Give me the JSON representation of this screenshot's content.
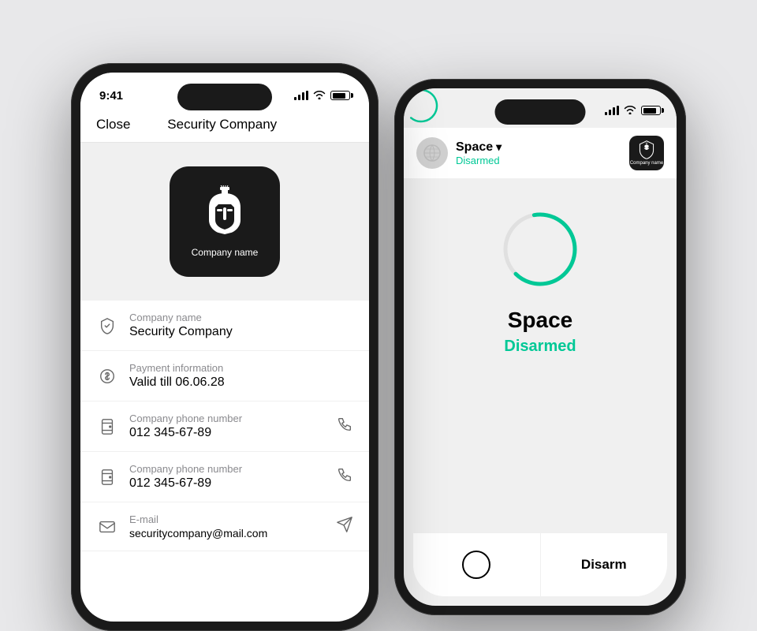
{
  "scene": {
    "bg_color": "#e8e8ea"
  },
  "phone1": {
    "status_bar": {
      "time": "9:41"
    },
    "nav": {
      "close_label": "Close",
      "title": "Security Company"
    },
    "logo": {
      "company_name": "Company name"
    },
    "rows": [
      {
        "label": "Company name",
        "value": "Security Company",
        "icon": "shield",
        "has_action": false
      },
      {
        "label": "Payment information",
        "value": "Valid till 06.06.28",
        "icon": "dollar",
        "has_action": false
      },
      {
        "label": "Company phone number",
        "value": "012 345-67-89",
        "icon": "phone-outline",
        "has_action": true
      },
      {
        "label": "Company phone number",
        "value": "012 345-67-89",
        "icon": "phone-outline",
        "has_action": true
      },
      {
        "label": "E-mail",
        "value": "securitycompany@mail.com",
        "icon": "mail",
        "has_action": true
      }
    ]
  },
  "phone2": {
    "header": {
      "space_name": "Space",
      "chevron": "▾",
      "status": "Disarmed",
      "company_label": "Company name"
    },
    "main": {
      "space_label": "Space",
      "disarmed_label": "Disarmed"
    },
    "bottom": {
      "disarm_label": "Disarm"
    }
  }
}
